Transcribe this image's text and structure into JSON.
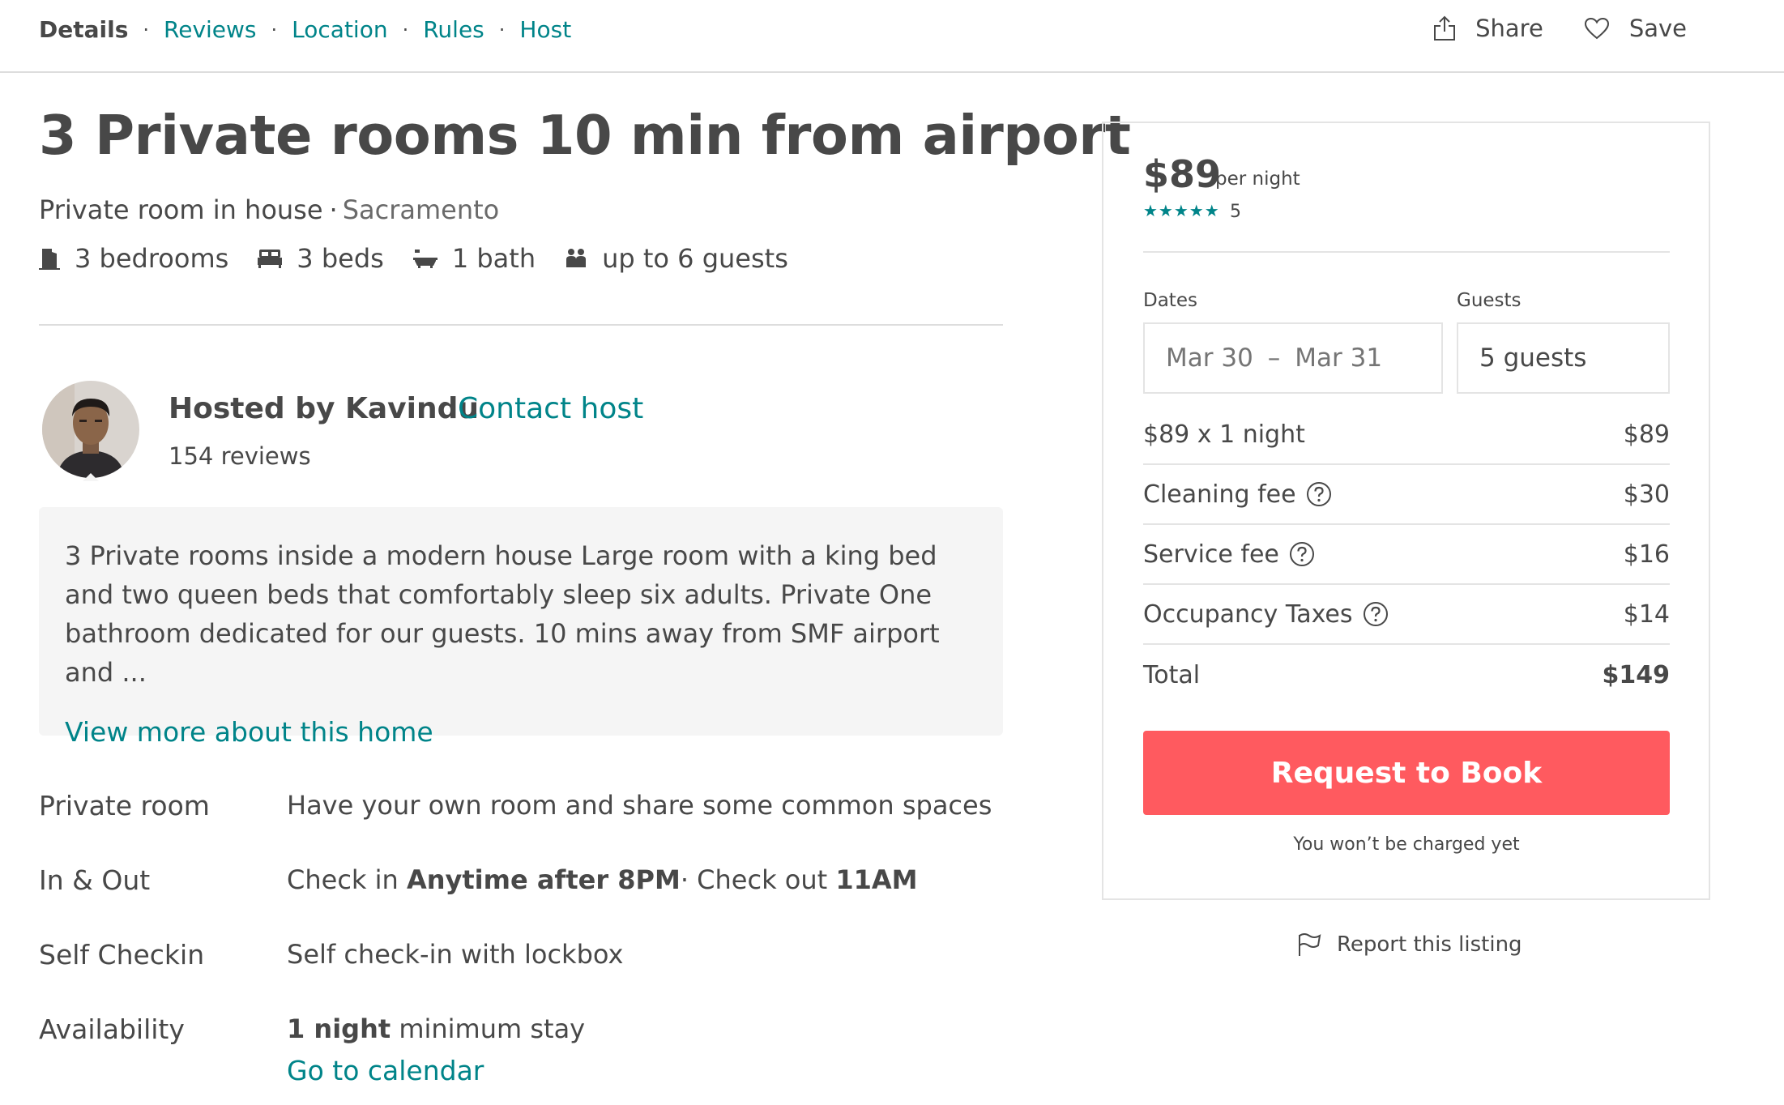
{
  "nav": {
    "links": [
      "Details",
      "Reviews",
      "Location",
      "Rules",
      "Host"
    ],
    "separator": "·",
    "share_label": "Share",
    "save_label": "Save"
  },
  "listing": {
    "title": "3 Private rooms 10 min from airport",
    "room_type": "Private room in house",
    "separator": "·",
    "city": "Sacramento",
    "facts": {
      "bedrooms": "3 bedrooms",
      "beds": "3 beds",
      "baths": "1 bath",
      "guests": "up to 6 guests"
    }
  },
  "host": {
    "hosted_by": "Hosted by Kavindu",
    "contact": "Contact host",
    "reviews": "154 reviews"
  },
  "description": {
    "text": "3 Private rooms inside a modern house Large room with a king bed and two queen beds that comfortably sleep six adults. Private One bathroom dedicated for our guests. 10 mins away from SMF airport and ...",
    "view_more": "View more about this home"
  },
  "details": {
    "private_room": {
      "label": "Private room",
      "value": "Have your own room and share some common spaces"
    },
    "in_out": {
      "label": "In & Out",
      "check_in_prefix": "Check in",
      "check_in_value": "Anytime after 8PM",
      "check_out_prefix": "· Check out",
      "check_out_value": "11AM"
    },
    "self_checkin": {
      "label": "Self Checkin",
      "value": "Self check-in with lockbox"
    },
    "availability": {
      "label": "Availability",
      "nights": "1 night",
      "suffix": "minimum stay",
      "calendar_link": "Go to calendar"
    }
  },
  "booking": {
    "price": "$89",
    "per_night": "per night",
    "stars": "★★★★★",
    "rating_count": "5",
    "dates_label": "Dates",
    "guests_label": "Guests",
    "check_in": "Mar 30",
    "dash": "–",
    "check_out": "Mar 31",
    "guests_value": "5 guests",
    "fees": [
      {
        "label": "$89 x 1 night",
        "amount": "$89"
      },
      {
        "label": "Cleaning fee",
        "amount": "$30"
      },
      {
        "label": "Service fee",
        "amount": "$16"
      },
      {
        "label": "Occupancy Taxes",
        "amount": "$14"
      }
    ],
    "total_label": "Total",
    "total_amount": "$149",
    "book_button": "Request to Book",
    "charge_note": "You won’t be charged yet",
    "report": "Report this listing"
  },
  "colors": {
    "accent_teal": "#008489",
    "book_button": "#ff5a5f",
    "text": "#484848"
  }
}
